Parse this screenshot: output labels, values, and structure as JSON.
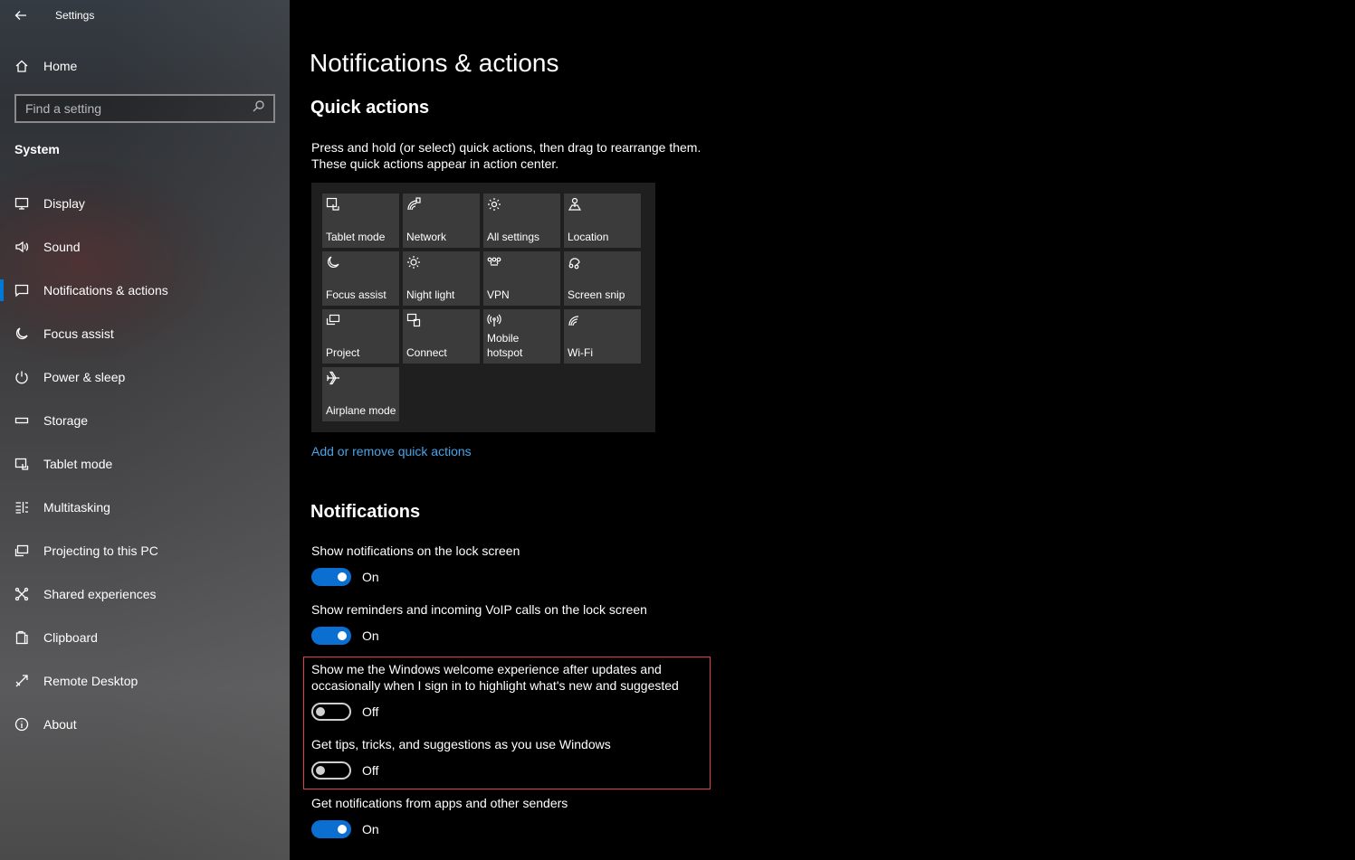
{
  "window": {
    "title": "Settings"
  },
  "sidebar": {
    "home_label": "Home",
    "search_placeholder": "Find a setting",
    "section_label": "System",
    "items": [
      {
        "label": "Display",
        "icon": "display-icon"
      },
      {
        "label": "Sound",
        "icon": "sound-icon"
      },
      {
        "label": "Notifications & actions",
        "icon": "notifications-icon",
        "active": true
      },
      {
        "label": "Focus assist",
        "icon": "moon-icon"
      },
      {
        "label": "Power & sleep",
        "icon": "power-icon"
      },
      {
        "label": "Storage",
        "icon": "storage-icon"
      },
      {
        "label": "Tablet mode",
        "icon": "tablet-mode-icon"
      },
      {
        "label": "Multitasking",
        "icon": "multitasking-icon"
      },
      {
        "label": "Projecting to this PC",
        "icon": "projecting-icon"
      },
      {
        "label": "Shared experiences",
        "icon": "shared-experiences-icon"
      },
      {
        "label": "Clipboard",
        "icon": "clipboard-icon"
      },
      {
        "label": "Remote Desktop",
        "icon": "remote-desktop-icon"
      },
      {
        "label": "About",
        "icon": "info-icon"
      }
    ]
  },
  "main": {
    "title": "Notifications & actions",
    "quick_actions": {
      "heading": "Quick actions",
      "desc_line1": "Press and hold (or select) quick actions, then drag to rearrange them.",
      "desc_line2": "These quick actions appear in action center.",
      "tiles": [
        {
          "label": "Tablet mode",
          "icon": "tablet-mode-icon"
        },
        {
          "label": "Network",
          "icon": "network-icon"
        },
        {
          "label": "All settings",
          "icon": "gear-icon"
        },
        {
          "label": "Location",
          "icon": "location-icon"
        },
        {
          "label": "Focus assist",
          "icon": "moon-icon"
        },
        {
          "label": "Night light",
          "icon": "sun-icon"
        },
        {
          "label": "VPN",
          "icon": "vpn-icon"
        },
        {
          "label": "Screen snip",
          "icon": "screen-snip-icon"
        },
        {
          "label": "Project",
          "icon": "project-icon"
        },
        {
          "label": "Connect",
          "icon": "connect-icon"
        },
        {
          "label": "Mobile hotspot",
          "icon": "hotspot-icon"
        },
        {
          "label": "Wi-Fi",
          "icon": "wifi-icon"
        },
        {
          "label": "Airplane mode",
          "icon": "airplane-icon"
        }
      ],
      "link": "Add or remove quick actions"
    },
    "notifications": {
      "heading": "Notifications",
      "settings": [
        {
          "label": "Show notifications on the lock screen",
          "state": "On"
        },
        {
          "label": "Show reminders and incoming VoIP calls on the lock screen",
          "state": "On"
        },
        {
          "label_line1": "Show me the Windows welcome experience after updates and",
          "label_line2": "occasionally when I sign in to highlight what's new and suggested",
          "state": "Off"
        },
        {
          "label": "Get tips, tricks, and suggestions as you use Windows",
          "state": "Off"
        },
        {
          "label": "Get notifications from apps and other senders",
          "state": "On"
        }
      ]
    },
    "accent_color": "#0a6fd1",
    "highlight_color": "#e0404a"
  }
}
